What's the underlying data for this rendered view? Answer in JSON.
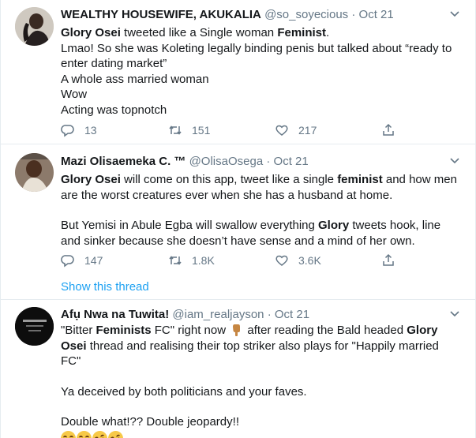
{
  "tweets": [
    {
      "name": "WEALTHY HOUSEWIFE, AKUKALIA",
      "handle": "@so_soyecious",
      "dot": "·",
      "date": "Oct 21",
      "lines": [
        {
          "parts": [
            {
              "t": "Glory Osei",
              "b": true
            },
            {
              "t": " tweeted like a Single woman ",
              "b": false
            },
            {
              "t": "Feminist",
              "b": true
            },
            {
              "t": ".",
              "b": false
            }
          ]
        },
        {
          "parts": [
            {
              "t": "Lmao! So she was Koleting legally binding penis but talked about “ready to enter dating market”",
              "b": false
            }
          ]
        },
        {
          "parts": [
            {
              "t": "A whole ass married woman",
              "b": false
            }
          ]
        },
        {
          "parts": [
            {
              "t": "Wow",
              "b": false
            }
          ]
        },
        {
          "parts": [
            {
              "t": "Acting was topnotch",
              "b": false
            }
          ]
        }
      ],
      "replies": "13",
      "retweets": "151",
      "likes": "217"
    },
    {
      "name": "Mazi Olisaemeka C. ™",
      "handle": "@OlisaOsega",
      "dot": "·",
      "date": "Oct 21",
      "lines": [
        {
          "parts": [
            {
              "t": "Glory Osei",
              "b": true
            },
            {
              "t": " will come on this app, tweet like a single ",
              "b": false
            },
            {
              "t": "feminist",
              "b": true
            },
            {
              "t": " and how men are the worst creatures ever when she has a husband at home.",
              "b": false
            }
          ]
        },
        {
          "gap": true
        },
        {
          "parts": [
            {
              "t": "But Yemisi in Abule Egba will swallow everything ",
              "b": false
            },
            {
              "t": "Glory",
              "b": true
            },
            {
              "t": " tweets hook, line and sinker because she doesn’t have sense and a mind of her own.",
              "b": false
            }
          ]
        }
      ],
      "replies": "147",
      "retweets": "1.8K",
      "likes": "3.6K",
      "show_thread": "Show this thread"
    },
    {
      "name": "Afụ Nwa na Tuwita!",
      "handle": "@iam_realjayson",
      "dot": "·",
      "date": "Oct 21",
      "lines": [
        {
          "parts": [
            {
              "t": "\"Bitter ",
              "b": false
            },
            {
              "t": "Feminists",
              "b": true
            },
            {
              "t": " FC\" right now ",
              "b": false
            },
            {
              "t": "__FINGER__",
              "b": false
            },
            {
              "t": " after reading the Bald headed ",
              "b": false
            },
            {
              "t": "Glory Osei",
              "b": true
            },
            {
              "t": " thread and realising their top striker also plays for \"Happily married FC\"",
              "b": false
            }
          ]
        },
        {
          "gap": true
        },
        {
          "parts": [
            {
              "t": "Ya deceived by both politicians and your faves.",
              "b": false
            }
          ]
        },
        {
          "gap": true
        },
        {
          "parts": [
            {
              "t": "Double what!?? Double jeopardy!!",
              "b": false
            }
          ]
        }
      ],
      "emoji": [
        "face-with-tears-of-joy",
        "face-with-tears-of-joy",
        "rolling-on-floor-laughing",
        "rolling-on-floor-laughing"
      ]
    }
  ],
  "icons": {
    "reply": "reply-icon",
    "retweet": "retweet-icon",
    "like": "like-icon",
    "share": "share-icon",
    "caret": "chevron-down-icon"
  },
  "colors": {
    "text": "#14171a",
    "muted": "#657786",
    "link": "#1da1f2",
    "border": "#e6ecf0"
  }
}
